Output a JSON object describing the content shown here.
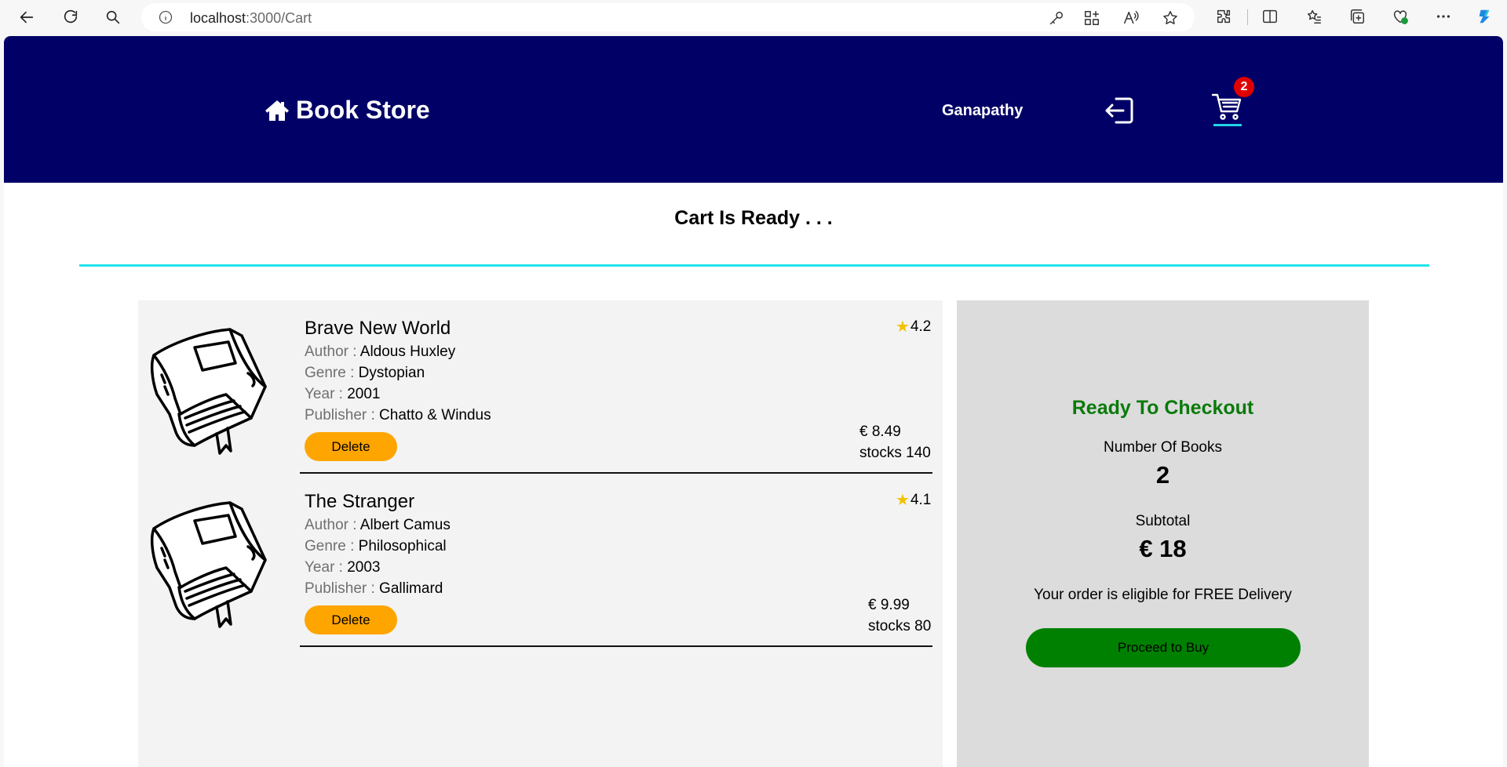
{
  "browser": {
    "url_host": "localhost",
    "url_path": ":3000/Cart"
  },
  "navbar": {
    "brand": "Book Store",
    "username": "Ganapathy",
    "cart_count": "2",
    "bg_color": "#000066"
  },
  "page": {
    "heading": "Cart Is Ready . . ."
  },
  "cart_items": [
    {
      "title": "Brave New World",
      "author_label": "Author : ",
      "author": "Aldous Huxley",
      "genre_label": "Genre : ",
      "genre": "Dystopian",
      "year_label": "Year : ",
      "year": "2001",
      "publisher_label": "Publisher : ",
      "publisher": "Chatto & Windus",
      "rating": "4.2",
      "price": "€ 8.49",
      "stock": "stocks 140",
      "delete_label": "Delete"
    },
    {
      "title": "The Stranger",
      "author_label": "Author : ",
      "author": "Albert Camus",
      "genre_label": "Genre : ",
      "genre": "Philosophical",
      "year_label": "Year : ",
      "year": "2003",
      "publisher_label": "Publisher : ",
      "publisher": "Gallimard",
      "rating": "4.1",
      "price": "€ 9.99",
      "stock": "stocks 80",
      "delete_label": "Delete"
    }
  ],
  "summary": {
    "title": "Ready To Checkout",
    "count_label": "Number Of Books",
    "count_value": "2",
    "subtotal_label": "Subtotal",
    "subtotal_value": "€ 18",
    "delivery_note": "Your order is eligible for FREE Delivery",
    "proceed_label": "Proceed to Buy"
  },
  "colors": {
    "delete_button": "#ffa500",
    "proceed_button": "#008000",
    "checkout_title": "#0a7a0a",
    "accent_line": "#22e4ec",
    "badge": "#e00000"
  }
}
